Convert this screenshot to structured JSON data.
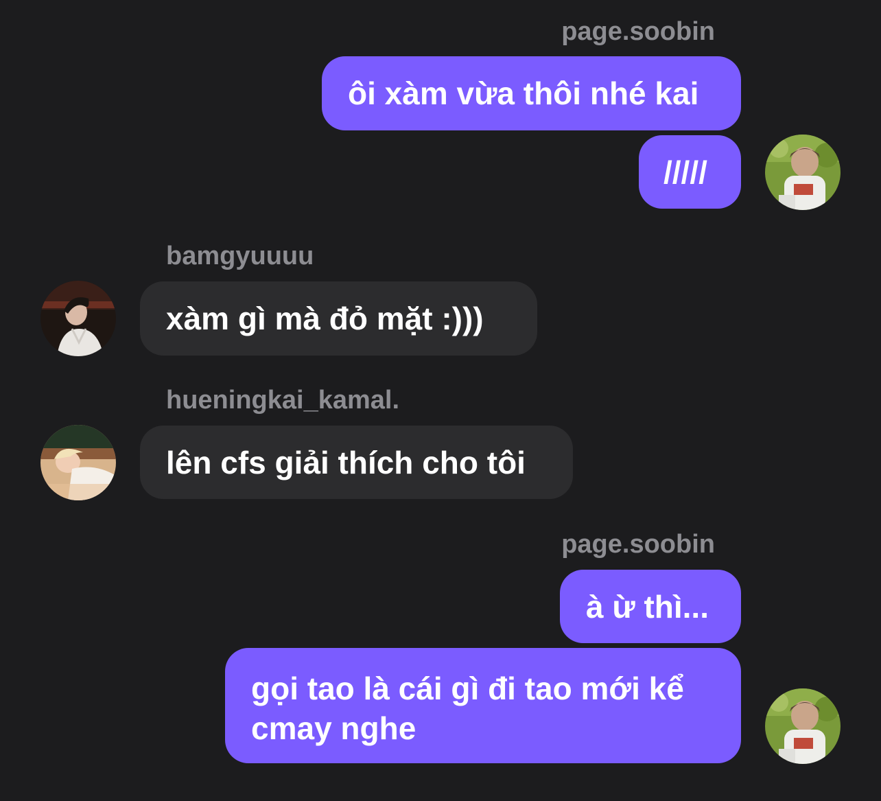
{
  "messages": [
    {
      "sender": "page.soobin",
      "text": "ôi xàm vừa thôi nhé kai"
    },
    {
      "text": "/////"
    },
    {
      "sender": "bamgyuuuu",
      "text": "xàm gì mà đỏ mặt :)))"
    },
    {
      "sender": "hueningkai_kamal.",
      "text": "lên cfs giải thích cho tôi"
    },
    {
      "sender": "page.soobin",
      "text": "à ừ thì..."
    },
    {
      "text": "gọi tao là cái gì đi tao mới kể cmay nghe"
    }
  ],
  "colors": {
    "background": "#1c1c1e",
    "own_bubble": "#7b5cff",
    "other_bubble": "#2c2c2e",
    "sender_name": "#8d8d92"
  }
}
